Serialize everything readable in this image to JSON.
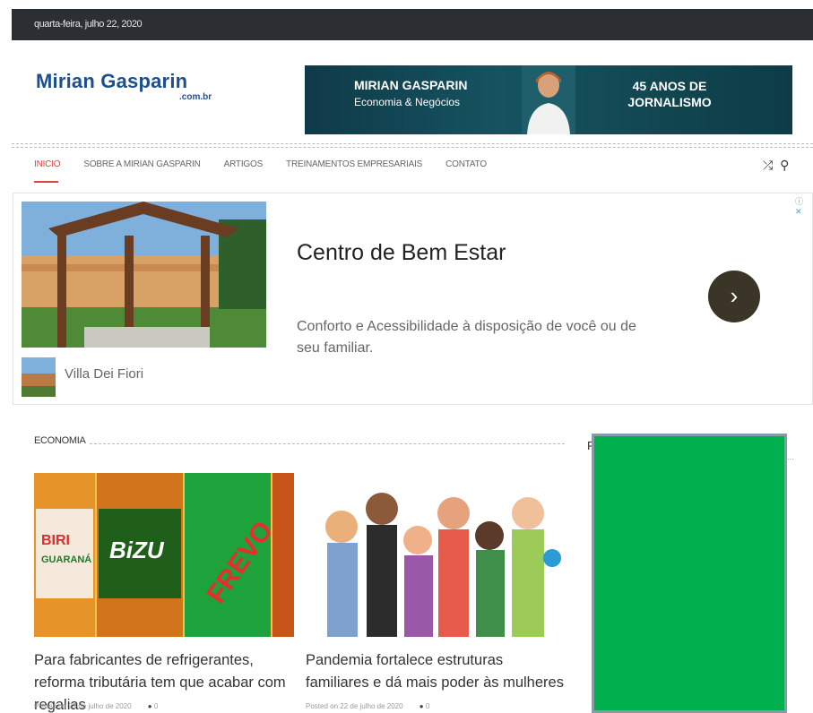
{
  "topbar": {
    "date": "quarta-feira, julho 22, 2020"
  },
  "logo": {
    "name": "Mirian Gasparin",
    "tld": ".com.br"
  },
  "banner": {
    "line1": "MIRIAN GASPARIN",
    "line2": "Economia & Negócios",
    "line3": "45 ANOS DE JORNALISMO"
  },
  "nav": {
    "items": [
      "INICIO",
      "SOBRE A MIRIAN GASPARIN",
      "ARTIGOS",
      "TREINAMENTOS EMPRESARIAIS",
      "CONTATO"
    ],
    "active": "INICIO",
    "icons": [
      "shuffle-icon",
      "search-icon"
    ]
  },
  "ad": {
    "title": "Centro de Bem Estar",
    "description": "Conforto e Acessibilidade à disposição de você ou de seu familiar.",
    "brand": "Villa Dei Fiori",
    "arrow": "›",
    "adchoice": "ⓘ ✕"
  },
  "section": {
    "title": "ECONOMIA"
  },
  "posts": [
    {
      "title": "Para fabricantes de refrigerantes, reforma tributária tem que acabar com regalias",
      "meta": "Posted on 22 de julho de 2020",
      "comments": "0"
    },
    {
      "title": "Pandemia fortalece estruturas familiares e dá mais poder às mulheres",
      "meta": "Posted on 22 de julho de 2020",
      "comments": "0"
    }
  ],
  "sidebar": {
    "initial": "P",
    "dots": "..."
  },
  "colors": {
    "accent": "#d64540",
    "brand": "#1b4f8f",
    "topbar": "#2b2f33",
    "green": "#00b04f"
  }
}
